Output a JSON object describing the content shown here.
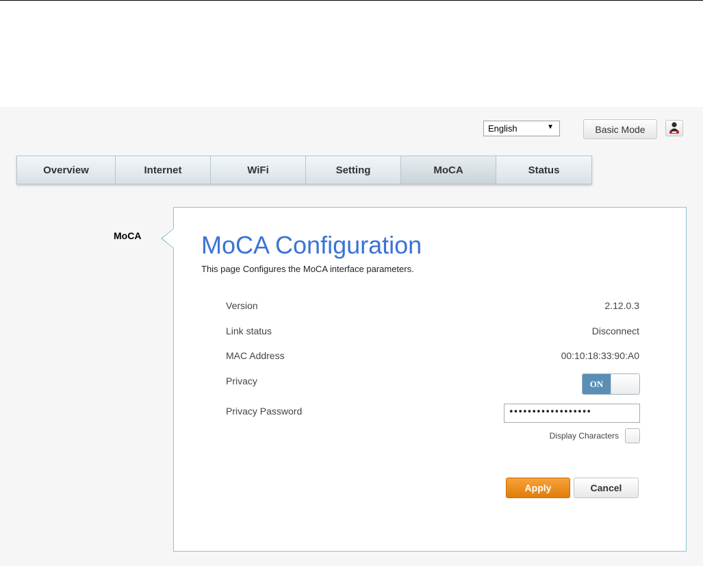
{
  "header": {
    "language": {
      "selected": "English"
    },
    "basic_mode_label": "Basic Mode",
    "user_icon": "user-icon"
  },
  "tabs": [
    {
      "label": "Overview",
      "active": false
    },
    {
      "label": "Internet",
      "active": false
    },
    {
      "label": "WiFi",
      "active": false
    },
    {
      "label": "Setting",
      "active": false
    },
    {
      "label": "MoCA",
      "active": true
    },
    {
      "label": "Status",
      "active": false
    }
  ],
  "sidebar": {
    "items": [
      {
        "label": "MoCA",
        "active": true
      }
    ]
  },
  "main": {
    "title": "MoCA Configuration",
    "description": "This page Configures the MoCA interface parameters.",
    "fields": {
      "version": {
        "label": "Version",
        "value": "2.12.0.3"
      },
      "link_status": {
        "label": "Link status",
        "value": "Disconnect"
      },
      "mac_address": {
        "label": "MAC Address",
        "value": "00:10:18:33:90:A0"
      },
      "privacy": {
        "label": "Privacy",
        "toggle_label": "ON",
        "enabled": true
      },
      "privacy_password": {
        "label": "Privacy Password",
        "value": "••••••••••••••••••"
      },
      "display_characters": {
        "label": "Display Characters",
        "checked": false
      }
    },
    "buttons": {
      "apply_label": "Apply",
      "cancel_label": "Cancel"
    }
  },
  "colors": {
    "title": "#3a73d6",
    "apply": "#e8880f",
    "toggle_on": "#5a8fb5",
    "panel_border": "#8ec1d0"
  }
}
